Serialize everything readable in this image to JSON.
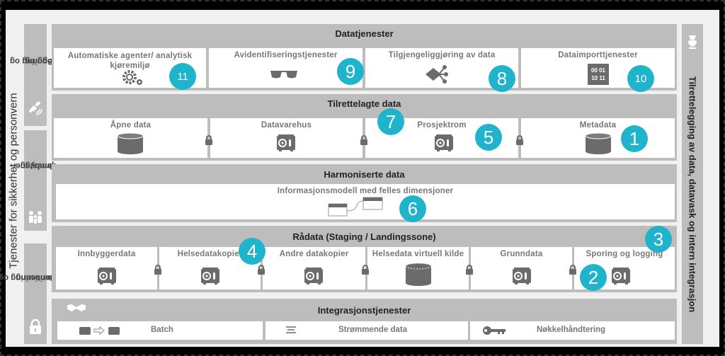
{
  "left_label": "Tjenester for sikkerhet og personvern",
  "right_label": "Tilrettelegging av data, datavask og intern integrasjon",
  "sidebar": [
    {
      "label_line1": "Sporing og",
      "label_line2": "logging",
      "icon": "satellite-icon"
    },
    {
      "label_line1": "Innbygger-",
      "label_line2": "tjenester",
      "icon": "family-icon"
    },
    {
      "label_line1": "Autentisering og",
      "label_line2": "autorisering",
      "icon": "lock-icon"
    }
  ],
  "layers": {
    "datatjenester": {
      "title": "Datatjenester",
      "cells": [
        {
          "label_line1": "Automatiske agenter/ analytisk",
          "label_line2": "kjøremiljø",
          "icon": "gears-icon",
          "badge": "11"
        },
        {
          "label": "Avidentifiseringstjenester",
          "icon": "sunglasses-icon",
          "badge": "9"
        },
        {
          "label": "Tilgjengeliggjøring av data",
          "icon": "share-diamond-icon",
          "badge": "8"
        },
        {
          "label": "Dataimporttjenester",
          "icon": "binary-icon",
          "icon_text_1": "00 01",
          "icon_text_2": "10 11",
          "badge": "10"
        }
      ]
    },
    "tilrettelagte": {
      "title": "Tilrettelagte data",
      "title_badge": "7",
      "cells": [
        {
          "label": "Åpne data",
          "icon": "database-icon"
        },
        {
          "label": "Datavarehus",
          "icon": "safe-icon"
        },
        {
          "label": "Prosjektrom",
          "icon": "safe-icon",
          "badge": "5"
        },
        {
          "label": "Metadata",
          "icon": "database-icon",
          "badge": "1"
        }
      ]
    },
    "harmoniserte": {
      "title": "Harmoniserte data",
      "cells": [
        {
          "label": "Informasjonsmodell med felles dimensjoner",
          "icon": "linked-tables-icon",
          "badge": "6"
        }
      ]
    },
    "radata": {
      "title": "Rådata (Staging / Landingssone)",
      "title_badge": "3",
      "cells": [
        {
          "label": "Innbyggerdata",
          "icon": "safe-icon"
        },
        {
          "label": "Helsedatakopier",
          "icon": "safe-icon",
          "badge": "4"
        },
        {
          "label": "Andre datakopier",
          "icon": "safe-icon"
        },
        {
          "label": "Helsedata virtuell kilde",
          "icon": "database-icon"
        },
        {
          "label": "Grunndata",
          "icon": "safe-icon"
        },
        {
          "label": "Sporing og logging",
          "icon": "safe-icon",
          "badge": "2"
        }
      ]
    },
    "integrasjon": {
      "title": "Integrasjonstjenester",
      "icon": "handshake-icon",
      "cells": [
        {
          "label": "Batch",
          "icon": "db-transfer-icon"
        },
        {
          "label": "Strømmende data",
          "icon": "stream-icon"
        },
        {
          "label": "Nøkkelhåndtering",
          "icon": "key-icon"
        }
      ]
    }
  },
  "colors": {
    "badge": "#1fb3cc",
    "panel": "#bdbdbd",
    "icon": "#6b6b6b",
    "background": "#f0f0f0"
  }
}
